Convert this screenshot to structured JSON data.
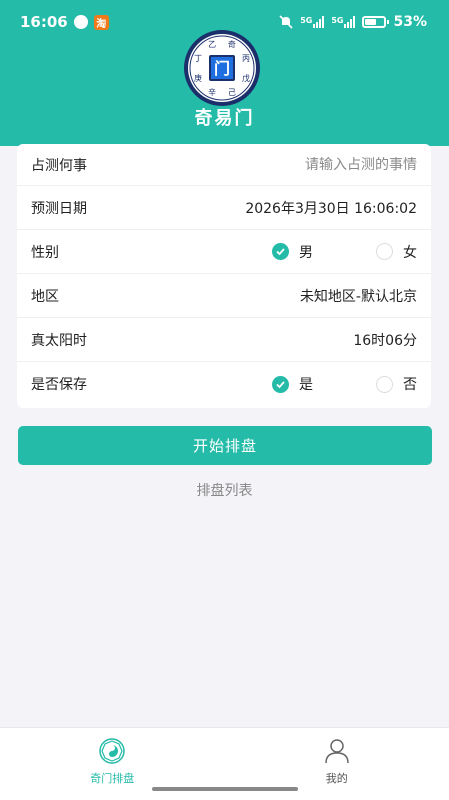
{
  "status_bar": {
    "time": "16:06",
    "taobao_icon_text": "淘",
    "signal1_label": "5G",
    "signal2_label": "5G",
    "battery_text": "53%"
  },
  "header": {
    "app_title": "奇易门",
    "logo_center_char": "门",
    "logo_ring_chars": [
      "乙",
      "奇",
      "丙",
      "戊",
      "己",
      "辛",
      "庚",
      "丁"
    ],
    "colors": {
      "primary": "#25bba9"
    }
  },
  "form": {
    "question": {
      "label": "占测何事",
      "placeholder": "请输入占测的事情"
    },
    "date": {
      "label": "预测日期",
      "value": "2026年3月30日 16:06:02"
    },
    "gender": {
      "label": "性别",
      "options": [
        "男",
        "女"
      ],
      "selected": "男"
    },
    "region": {
      "label": "地区",
      "value": "未知地区-默认北京"
    },
    "solar_time": {
      "label": "真太阳时",
      "value": "16时06分"
    },
    "save": {
      "label": "是否保存",
      "options": [
        "是",
        "否"
      ],
      "selected": "是"
    }
  },
  "actions": {
    "start_label": "开始排盘",
    "list_label": "排盘列表"
  },
  "tabbar": {
    "items": [
      {
        "label": "奇门排盘",
        "icon": "qimen-chart-icon",
        "active": true
      },
      {
        "label": "我的",
        "icon": "user-icon",
        "active": false
      }
    ]
  }
}
